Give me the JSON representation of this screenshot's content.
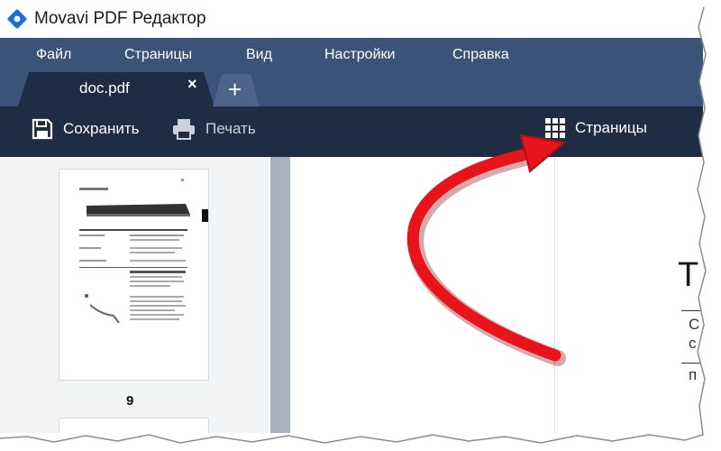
{
  "window": {
    "title": "Movavi PDF Редактор",
    "logo_icon": "movavi-diamond-icon",
    "accent": "#1d6fd1"
  },
  "menu": {
    "items": [
      "Файл",
      "Страницы",
      "Вид",
      "Настройки",
      "Справка"
    ]
  },
  "tabs": {
    "active_label": "doc.pdf",
    "close_icon": "close-icon",
    "add_label": "+"
  },
  "toolbar": {
    "save_label": "Сохранить",
    "print_label": "Печать",
    "pages_label": "Страницы"
  },
  "sidebar": {
    "page_number": "9"
  },
  "document": {
    "heading_fragment": "Т",
    "line1_fragment": "С",
    "line2_fragment": "с",
    "line3_fragment": "п"
  },
  "colors": {
    "menubar": "#3b5379",
    "toolbar": "#1f2d44",
    "arrow": "#e8141b"
  }
}
